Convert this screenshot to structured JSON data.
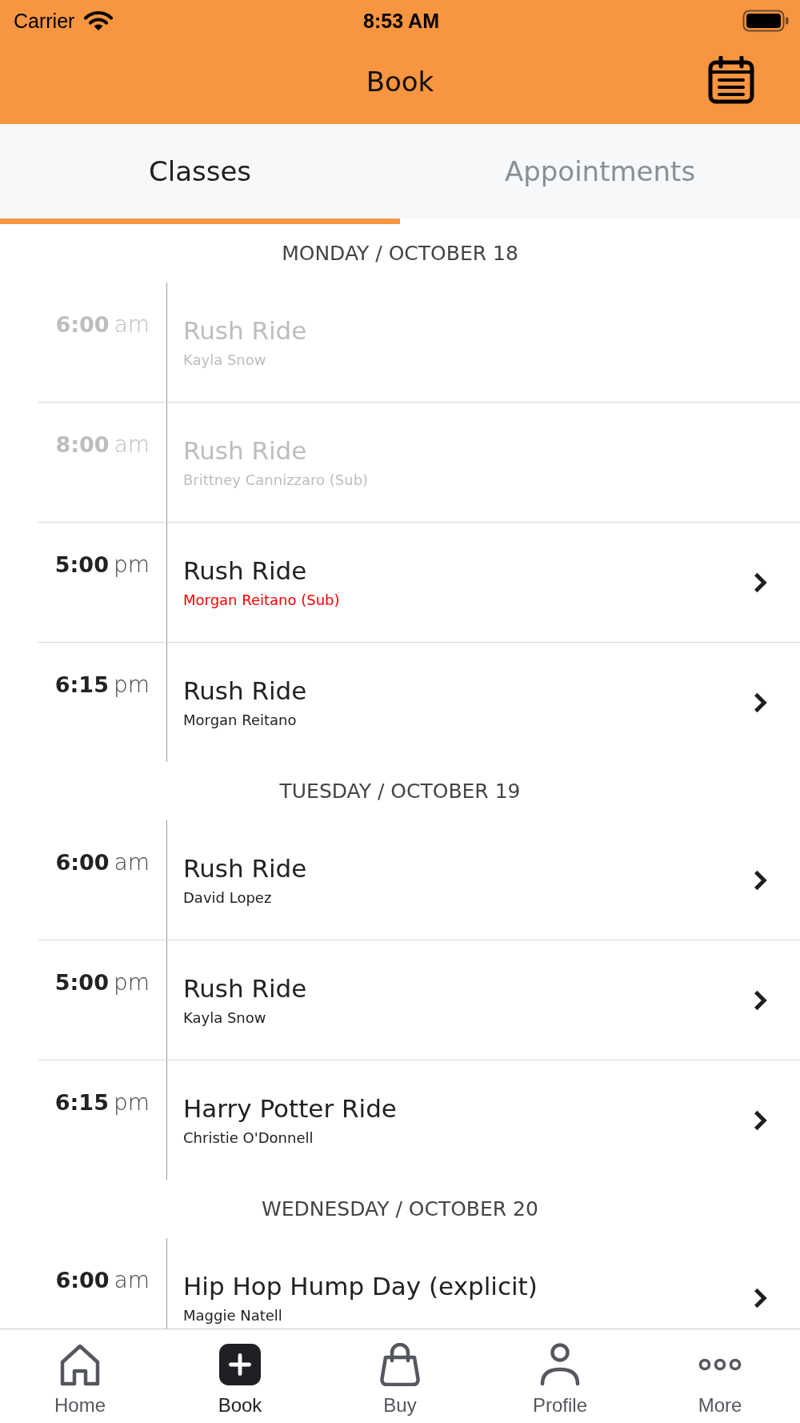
{
  "status_bar": {
    "carrier": "Carrier",
    "time": "8:53 AM"
  },
  "header": {
    "title": "Book"
  },
  "tabs": [
    {
      "label": "Classes",
      "selected": true
    },
    {
      "label": "Appointments",
      "selected": false
    }
  ],
  "days": [
    {
      "heading": "MONDAY / OCTOBER 18",
      "classes": [
        {
          "time": "6:00",
          "period": "am",
          "name": "Rush Ride",
          "instructor": "Kayla Snow",
          "disabled": true,
          "highlighted": false
        },
        {
          "time": "8:00",
          "period": "am",
          "name": "Rush Ride",
          "instructor": "Brittney Cannizzaro (Sub)",
          "disabled": true,
          "highlighted": false
        },
        {
          "time": "5:00",
          "period": "pm",
          "name": "Rush Ride",
          "instructor": "Morgan Reitano (Sub)",
          "disabled": false,
          "highlighted": true
        },
        {
          "time": "6:15",
          "period": "pm",
          "name": "Rush Ride",
          "instructor": "Morgan Reitano",
          "disabled": false,
          "highlighted": false
        }
      ]
    },
    {
      "heading": "TUESDAY / OCTOBER 19",
      "classes": [
        {
          "time": "6:00",
          "period": "am",
          "name": "Rush Ride",
          "instructor": "David Lopez",
          "disabled": false,
          "highlighted": false
        },
        {
          "time": "5:00",
          "period": "pm",
          "name": "Rush Ride",
          "instructor": "Kayla Snow",
          "disabled": false,
          "highlighted": false
        },
        {
          "time": "6:15",
          "period": "pm",
          "name": "Harry Potter Ride",
          "instructor": "Christie O'Donnell",
          "disabled": false,
          "highlighted": false
        }
      ]
    },
    {
      "heading": "WEDNESDAY / OCTOBER 20",
      "classes": [
        {
          "time": "6:00",
          "period": "am",
          "name": "Hip Hop Hump Day (explicit)",
          "instructor": "Maggie Natell",
          "disabled": false,
          "highlighted": false
        }
      ]
    }
  ],
  "tab_bar": [
    {
      "label": "Home",
      "kind": "home",
      "selected": false
    },
    {
      "label": "Book",
      "kind": "book",
      "selected": true
    },
    {
      "label": "Buy",
      "kind": "bag",
      "selected": false
    },
    {
      "label": "Profile",
      "kind": "profile",
      "selected": false
    },
    {
      "label": "More",
      "kind": "more",
      "selected": false
    }
  ]
}
